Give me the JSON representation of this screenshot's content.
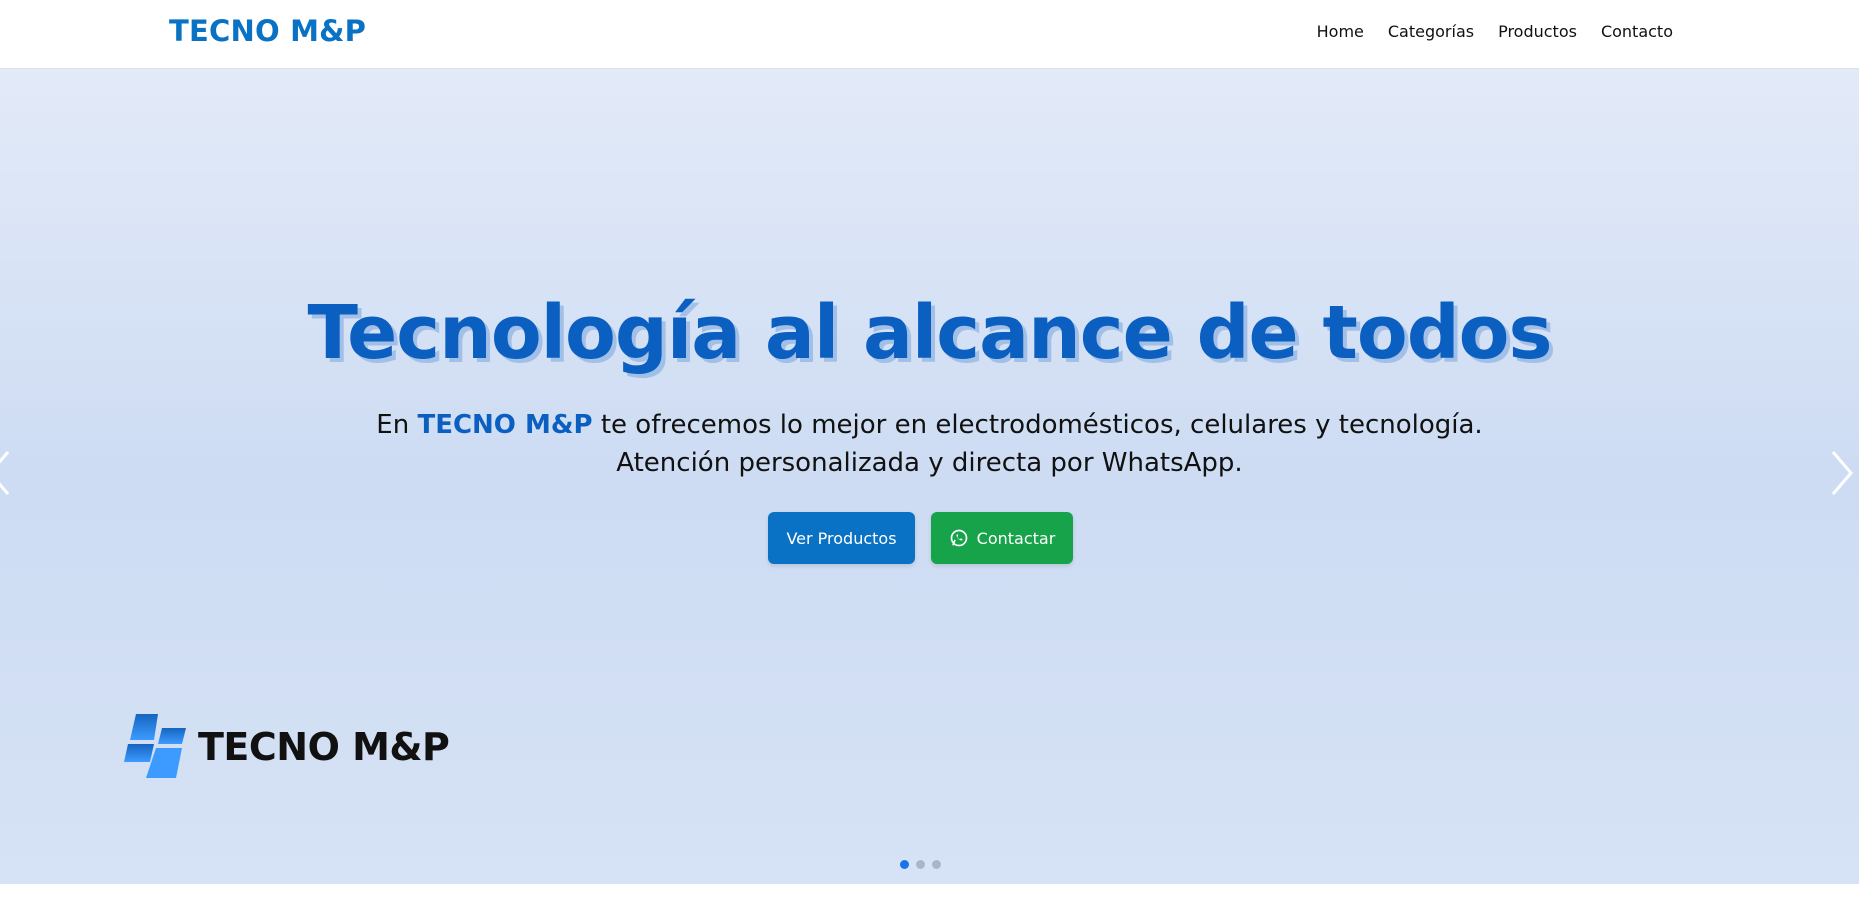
{
  "navbar": {
    "brand": "TECNO M&P",
    "links": [
      "Home",
      "Categorías",
      "Productos",
      "Contacto"
    ]
  },
  "hero": {
    "title": "Tecnología al alcance de todos",
    "subtitle_prefix": "En ",
    "subtitle_brand": "TECNO M&P",
    "subtitle_rest": " te ofrecemos lo mejor en electrodomésticos, celulares y tecnología.",
    "subtitle_line2": "Atención personalizada y directa por WhatsApp.",
    "buttons": {
      "products": "Ver Productos",
      "contact": "Contactar"
    },
    "logo_text": "TECNO M&P"
  },
  "carousel": {
    "slide_count": 3,
    "active_index": 0,
    "prev_icon": "chevron-left-icon",
    "next_icon": "chevron-right-icon"
  },
  "colors": {
    "brand_blue": "#0a72c4",
    "title_blue": "#0b5fc0",
    "whatsapp_green": "#16a34a",
    "hero_bg": "#cddcf3"
  }
}
